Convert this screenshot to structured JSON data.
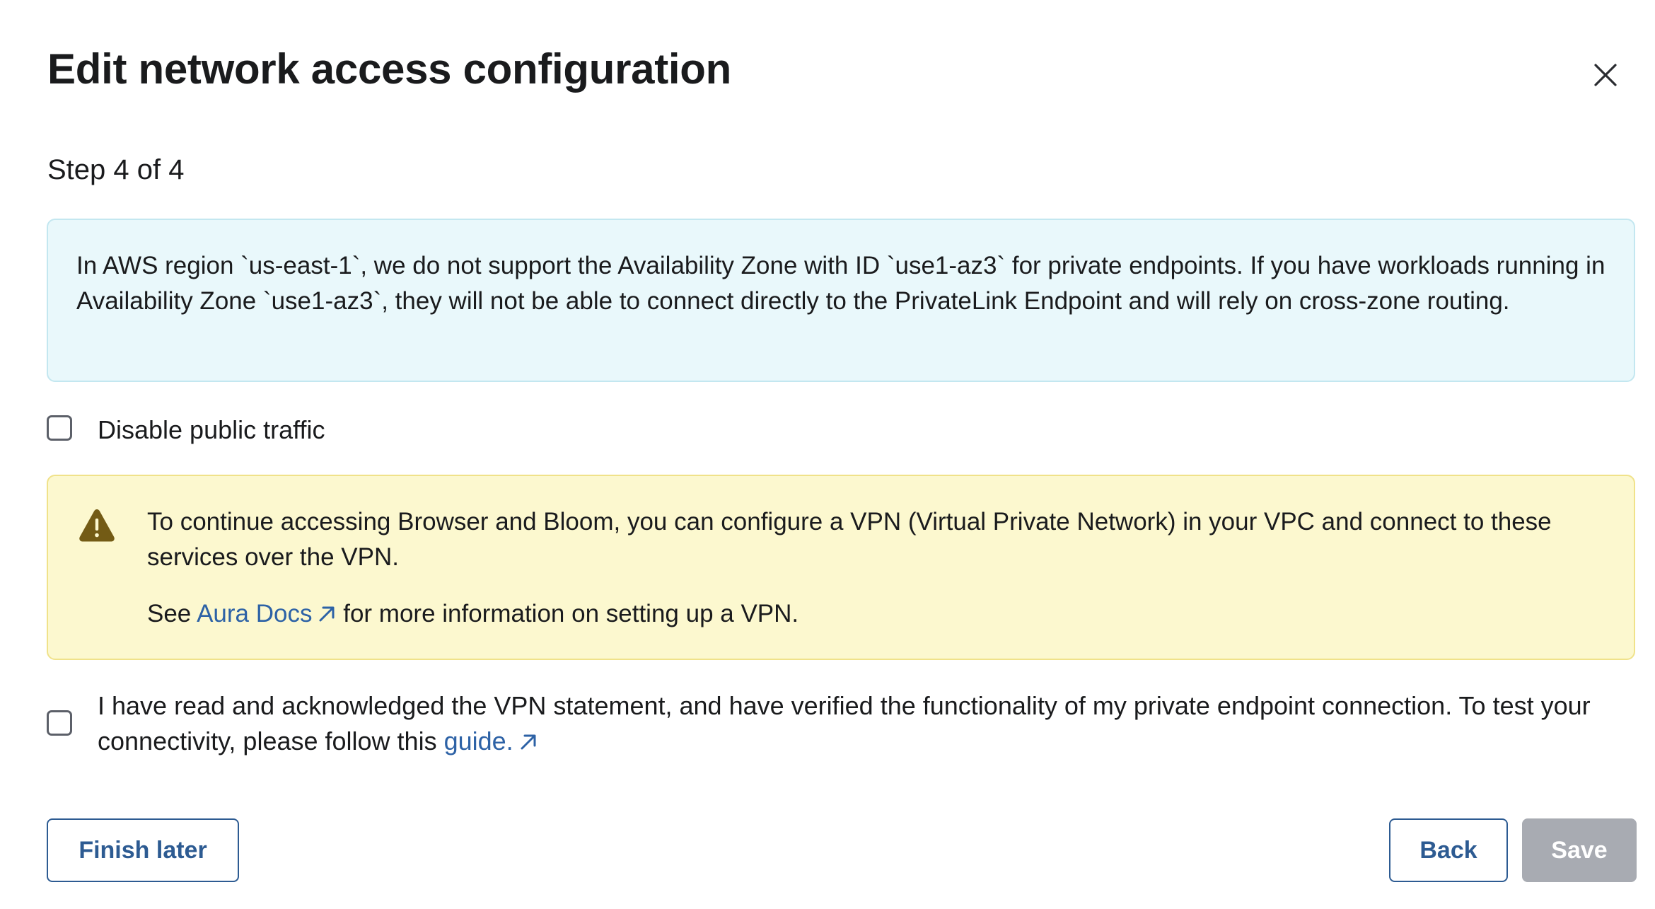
{
  "dialog": {
    "title": "Edit network access configuration",
    "close_icon": "close-icon",
    "step_text": "Step 4 of 4"
  },
  "info_notice": {
    "text": "In AWS region `us-east-1`, we do not support the Availability Zone with ID `use1-az3` for private endpoints. If you have workloads running in Availability Zone `use1-az3`, they will not be able to connect directly to the PrivateLink Endpoint and will rely on cross-zone routing."
  },
  "disable_public_traffic": {
    "label": "Disable public traffic",
    "checked": false
  },
  "vpn_warning": {
    "icon": "warning-icon",
    "paragraph1": "To continue accessing Browser and Bloom, you can configure a VPN (Virtual Private Network) in your VPC and connect to these services over the VPN.",
    "see_prefix": "See",
    "docs_link": "Aura Docs",
    "see_suffix": "for more information on setting up a VPN."
  },
  "acknowledge": {
    "text": "I have read and acknowledged the VPN statement, and have verified the functionality of my private endpoint connection. To test your connectivity, please follow this",
    "guide_link": "guide.",
    "checked": false
  },
  "footer": {
    "finish_later_label": "Finish later",
    "back_label": "Back",
    "save_label": "Save",
    "save_disabled": true
  },
  "colors": {
    "info_bg": "#e9f8fb",
    "warning_bg": "#fcf8cf",
    "warning_icon": "#735b15",
    "link": "#2d62a6",
    "primary_outline": "#2d5b92",
    "disabled": "#a8abb2"
  }
}
